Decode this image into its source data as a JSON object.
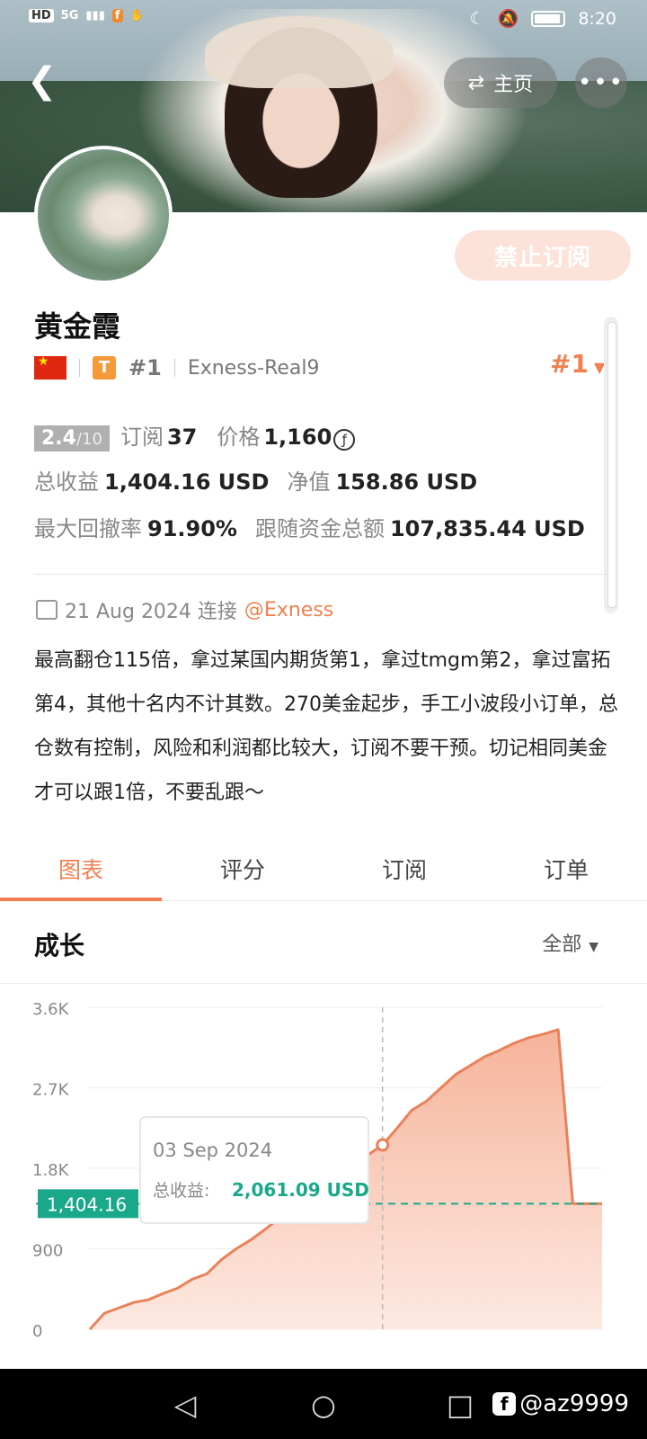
{
  "status_bar": {
    "hd": "HD",
    "network": "5G",
    "time": "8:20"
  },
  "header": {
    "home_label": "主页",
    "more_label": "•••",
    "subscribe_label": "禁止订阅"
  },
  "profile": {
    "name": "黄金霞",
    "tier_letter": "T",
    "rank": "#1",
    "server": "Exness-Real9",
    "rank_right": "#1"
  },
  "stats": {
    "score": "2.4",
    "score_max": "/10",
    "subs_label": "订阅",
    "subs_value": "37",
    "price_label": "价格",
    "price_value": "1,160",
    "coin_symbol": "ƒ",
    "profit_label": "总收益",
    "profit_value": "1,404.16 USD",
    "equity_label": "净值",
    "equity_value": "158.86 USD",
    "drawdown_label": "最大回撤率",
    "drawdown_value": "91.90%",
    "follow_label": "跟随资金总额",
    "follow_value": "107,835.44 USD"
  },
  "since": {
    "date": "21 Aug 2024 连接",
    "broker": "@Exness"
  },
  "bio": "最高翻仓115倍，拿过某国内期货第1，拿过tmgm第2，拿过富拓第4，其他十名内不计其数。270美金起步，手工小波段小订单，总仓数有控制，风险和利润都比较大，订阅不要干预。切记相同美金才可以跟1倍，不要乱跟～",
  "tabs": [
    "图表",
    "评分",
    "订阅",
    "订单"
  ],
  "section": {
    "title": "成长",
    "period": "全部"
  },
  "chart_data": {
    "type": "area",
    "title": "",
    "xlabel": "",
    "ylabel": "",
    "yticks": [
      "3.6K",
      "2.7K",
      "1.8K",
      "900",
      "0"
    ],
    "ylim": [
      0,
      3600
    ],
    "series": [
      {
        "values": [
          0,
          180,
          240,
          300,
          330,
          400,
          460,
          560,
          620,
          780,
          900,
          1000,
          1120,
          1250,
          1360,
          1480,
          1580,
          1700,
          1820,
          1950,
          2061.09,
          2250,
          2450,
          2550,
          2700,
          2850,
          2950,
          3050,
          3120,
          3200,
          3260,
          3300,
          3350,
          1404.16,
          1404.16,
          1404.16
        ]
      }
    ],
    "reference_line": 1404.16,
    "reference_label": "1,404.16",
    "highlight_index": 20,
    "tooltip": {
      "date": "03 Sep 2024",
      "label": "总收益:",
      "value": "2,061.09 USD"
    },
    "colors": {
      "line": "#e9825a",
      "fill_top": "#f6b39a",
      "fill_bottom": "#fde9e1",
      "reference": "#1aa88a"
    }
  },
  "nav": {
    "watermark": "@az9999"
  }
}
